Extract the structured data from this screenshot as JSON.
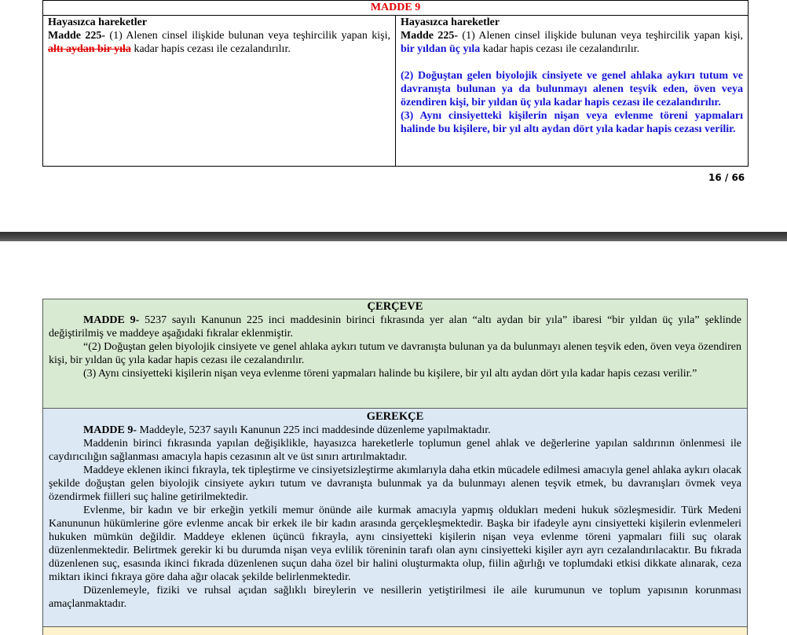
{
  "comparison": {
    "article_header": "MADDE 9",
    "left": {
      "title": "Hayasızca hareketler",
      "madde_label": "Madde 225-",
      "text_before": " (1) Alenen cinsel ilişkide bulunan veya teşhircilik yapan kişi, ",
      "struck_text": "altı aydan bir yıla",
      "text_after": " kadar hapis cezası ile cezalandırılır."
    },
    "right": {
      "title": "Hayasızca hareketler",
      "madde_label": "Madde 225-",
      "text_before": " (1) Alenen cinsel ilişkide bulunan veya teşhircilik yapan kişi, ",
      "new_text": "bir yıldan üç yıla",
      "text_after": " kadar hapis cezası ile cezalandırılır.",
      "added_para_2": "(2) Doğuştan gelen biyolojik cinsiyete ve genel ahlaka aykırı tutum ve davranışta bulunan ya da bulunmayı alenen teşvik eden, öven veya özendiren kişi, bir yıldan üç yıla kadar hapis cezası ile cezalandırılır.",
      "added_para_3": "(3) Aynı cinsiyetteki kişilerin nişan veya evlenme töreni yapmaları halinde bu kişilere, bir yıl altı aydan dört yıla kadar hapis cezası verilir."
    },
    "page_number": "16 / 66"
  },
  "cerceve": {
    "title": "ÇERÇEVE",
    "madde_label": "MADDE 9-",
    "p1": " 5237 sayılı Kanunun 225 inci maddesinin birinci fıkrasında yer alan “altı aydan bir yıla” ibaresi “bir yıldan üç yıla” şeklinde değiştirilmiş ve maddeye aşağıdaki fıkralar eklenmiştir.",
    "p2": "“(2) Doğuştan gelen biyolojik cinsiyete ve genel ahlaka aykırı tutum ve davranışta bulunan ya da bulunmayı alenen teşvik eden, öven veya özendiren kişi, bir yıldan üç yıla kadar hapis cezası ile cezalandırılır.",
    "p3": "(3) Aynı cinsiyetteki kişilerin nişan veya evlenme töreni yapmaları halinde bu kişilere, bir yıl altı aydan dört yıla kadar hapis cezası verilir.”"
  },
  "gerekce": {
    "title": "GEREKÇE",
    "madde_label": "MADDE 9-",
    "p1": " Maddeyle, 5237 sayılı Kanunun 225 inci maddesinde düzenleme yapılmaktadır.",
    "p2": "Maddenin birinci fıkrasında yapılan değişiklikle, hayasızca hareketlerle toplumun genel ahlak ve değerlerine yapılan saldırının önlenmesi ile caydırıcılığın sağlanması amacıyla hapis cezasının alt ve üst sınırı artırılmaktadır.",
    "p3": "Maddeye eklenen ikinci fıkrayla, tek tipleştirme ve cinsiyetsizleştirme akımlarıyla daha etkin mücadele edilmesi amacıyla genel ahlaka aykırı olacak şekilde doğuştan gelen biyolojik cinsiyete aykırı tutum ve davranışta bulunmak ya da bulunmayı alenen teşvik etmek, bu davranışları övmek veya özendirmek fiilleri suç haline getirilmektedir.",
    "p4": "Evlenme, bir kadın ve bir erkeğin yetkili memur önünde aile kurmak amacıyla yapmış oldukları medeni hukuk sözleşmesidir. Türk Medeni Kanununun hükümlerine göre evlenme ancak bir erkek ile bir kadın arasında gerçekleşmektedir. Başka bir ifadeyle aynı cinsiyetteki kişilerin evlenmeleri hukuken mümkün değildir. Maddeye eklenen üçüncü fıkrayla, aynı cinsiyetteki kişilerin nişan veya evlenme töreni yapmaları fiili suç olarak düzenlenmektedir. Belirtmek gerekir ki bu durumda nişan veya evlilik töreninin tarafı olan aynı cinsiyetteki kişiler ayrı ayrı cezalandırılacaktır. Bu fıkrada düzenlenen suç, esasında ikinci fıkrada düzenlenen suçun daha özel bir halini oluşturmakta olup, fiilin ağırlığı ve toplumdaki etkisi dikkate alınarak, ceza miktarı ikinci fıkraya göre daha ağır olacak şekilde belirlenmektedir.",
    "p5": "Düzenlemeyle, fiziki ve ruhsal açıdan sağlıklı bireylerin ve nesillerin yetiştirilmesi ile aile kurumunun ve toplum yapısının korunması amaçlanmaktadır."
  },
  "colors": {
    "strike_red": "#e00000",
    "added_blue": "#1515d6",
    "cerceve_bg": "#d9ead3",
    "gerekce_bg": "#dce9f5"
  }
}
